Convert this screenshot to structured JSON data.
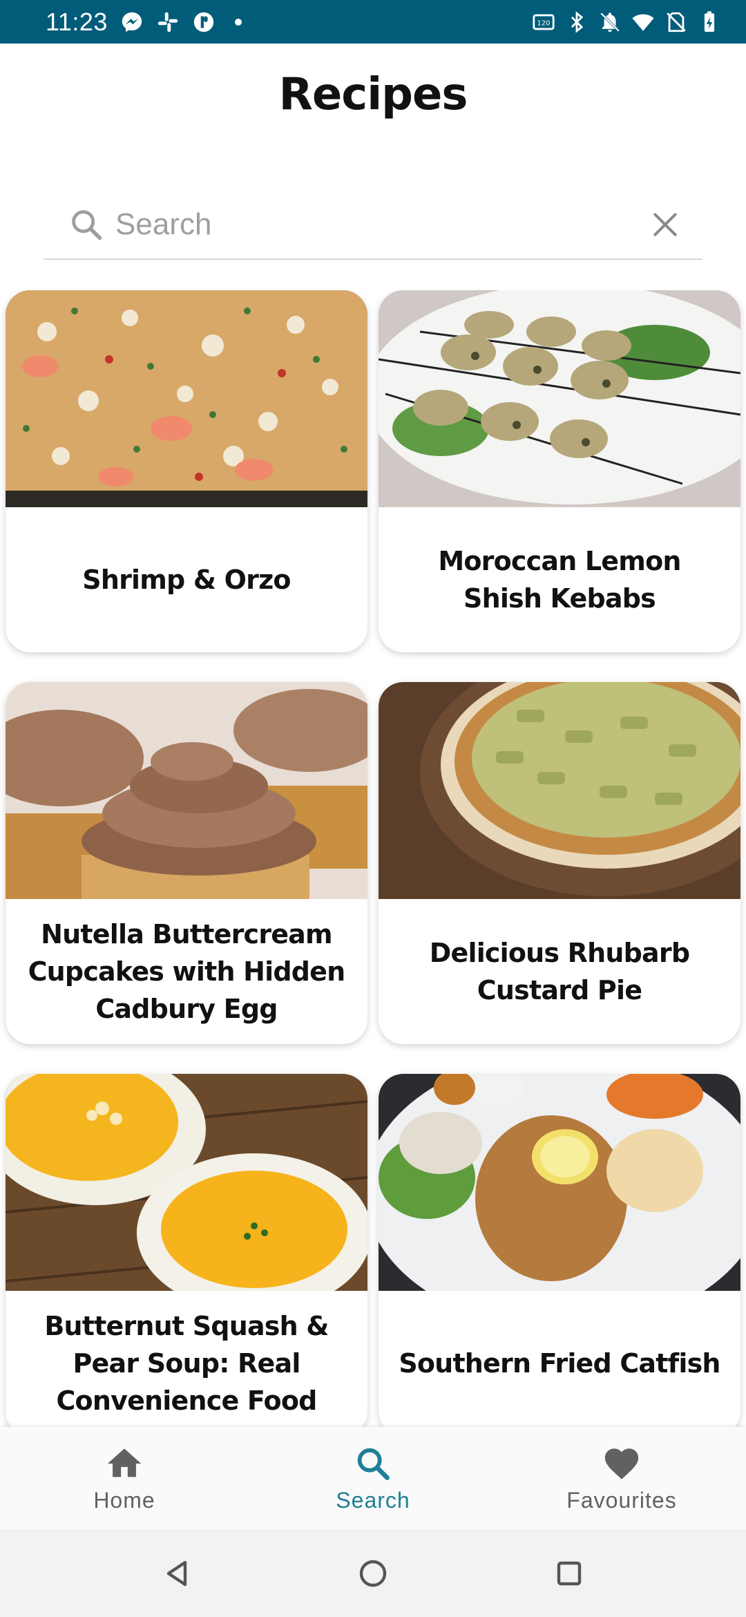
{
  "status_bar": {
    "time": "11:23",
    "left_icons": [
      "messenger-icon",
      "slack-icon",
      "pocket-icon",
      "dot-icon"
    ],
    "right_icons": [
      "refresh-rate-icon",
      "bluetooth-icon",
      "mute-icon",
      "wifi-icon",
      "no-sim-icon",
      "battery-icon"
    ],
    "bg_color": "#015c7a"
  },
  "header": {
    "title": "Recipes"
  },
  "search": {
    "placeholder": "Search",
    "value": ""
  },
  "recipes": [
    {
      "title": "Shrimp & Orzo"
    },
    {
      "title": "Moroccan Lemon Shish Kebabs"
    },
    {
      "title": "Nutella Buttercream Cupcakes with Hidden Cadbury Egg"
    },
    {
      "title": "Delicious Rhubarb Custard Pie"
    },
    {
      "title": "Butternut Squash & Pear Soup: Real Convenience Food"
    },
    {
      "title": "Southern Fried Catfish"
    }
  ],
  "bottom_nav": {
    "items": [
      {
        "label": "Home",
        "icon": "home-icon",
        "active": false
      },
      {
        "label": "Search",
        "icon": "search-icon",
        "active": true
      },
      {
        "label": "Favourites",
        "icon": "heart-icon",
        "active": false
      }
    ],
    "active_color": "#1f7f98",
    "inactive_color": "#616161"
  },
  "system_nav": [
    "back-icon",
    "home-circle-icon",
    "recents-icon"
  ]
}
